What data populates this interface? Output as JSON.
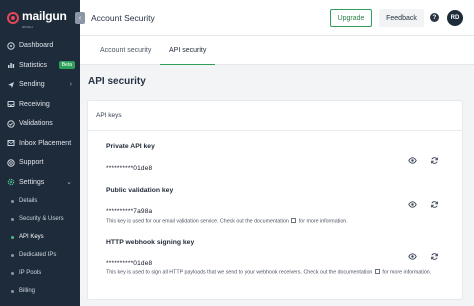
{
  "brand": {
    "name": "mailgun",
    "sub": "SINCH"
  },
  "sidebar": {
    "items": [
      {
        "label": "Dashboard",
        "icon": "dashboard-icon"
      },
      {
        "label": "Statistics",
        "icon": "chart-icon",
        "badge": "Beta"
      },
      {
        "label": "Sending",
        "icon": "send-icon",
        "chevron": "›"
      },
      {
        "label": "Receiving",
        "icon": "inbox-icon"
      },
      {
        "label": "Validations",
        "icon": "check-icon"
      },
      {
        "label": "Inbox Placement",
        "icon": "placement-icon"
      },
      {
        "label": "Support",
        "icon": "support-icon"
      },
      {
        "label": "Settings",
        "icon": "gear-icon",
        "chevron": "⌄"
      }
    ],
    "sub_items": [
      {
        "label": "Details"
      },
      {
        "label": "Security & Users"
      },
      {
        "label": "API Keys",
        "active": true
      },
      {
        "label": "Dedicated IPs"
      },
      {
        "label": "IP Pools"
      },
      {
        "label": "Billing"
      }
    ]
  },
  "header": {
    "title": "Account Security",
    "upgrade_label": "Upgrade",
    "feedback_label": "Feedback",
    "help_label": "?",
    "avatar_initials": "RD"
  },
  "tabs": [
    {
      "label": "Account security",
      "active": false
    },
    {
      "label": "API security",
      "active": true
    }
  ],
  "page_title": "API security",
  "card": {
    "header": "API keys",
    "keys": [
      {
        "title": "Private API key",
        "value": "**********01de8",
        "note": ""
      },
      {
        "title": "Public validation key",
        "value": "**********7a98a",
        "note_before": "This key is used for our email validation service. Check out the documentation",
        "note_after": "for more information."
      },
      {
        "title": "HTTP webhook signing key",
        "value": "**********01de8",
        "note_before": "This key is used to sign all HTTP payloads that we send to your webhook receivers. Check out the documentation",
        "note_after": "for more information."
      }
    ]
  },
  "colors": {
    "sidebar_bg": "#1e2b3b",
    "accent": "#2e9e5b",
    "brand_red": "#e4485a"
  }
}
